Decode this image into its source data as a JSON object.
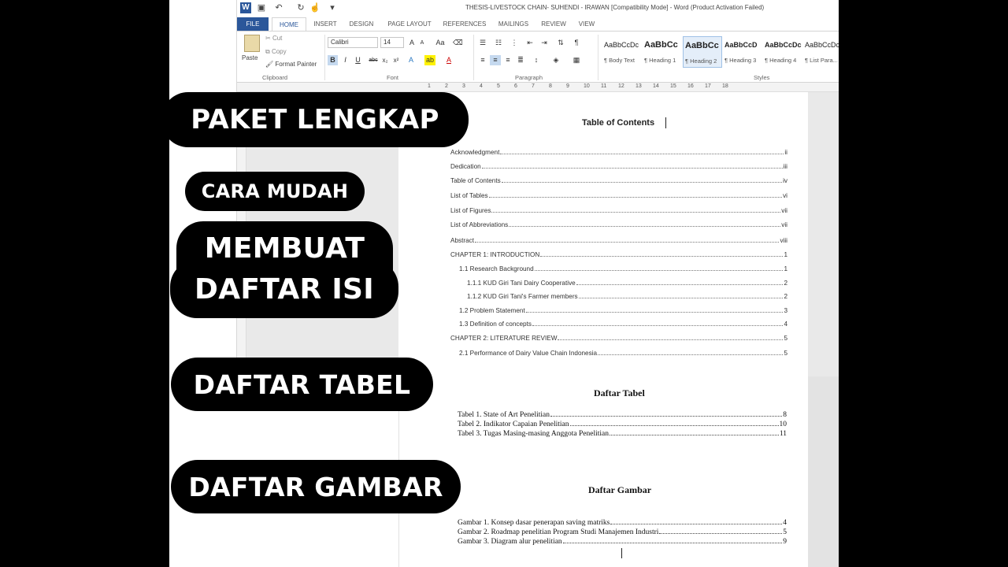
{
  "word": {
    "window_title": "THESIS-LIVESTOCK CHAIN- SUHENDI - IRAWAN  [Compatibility Mode] - Word (Product Activation Failed)",
    "tabs": [
      "FILE",
      "HOME",
      "INSERT",
      "DESIGN",
      "PAGE LAYOUT",
      "REFERENCES",
      "MAILINGS",
      "REVIEW",
      "VIEW"
    ],
    "clipboard": {
      "paste": "Paste",
      "cut": "Cut",
      "copy": "Copy",
      "format_painter": "Format Painter",
      "label": "Clipboard"
    },
    "font": {
      "name": "Calibri",
      "size": "14",
      "label": "Font"
    },
    "paragraph": {
      "label": "Paragraph"
    },
    "styles": {
      "label": "Styles",
      "items": [
        {
          "sample": "AaBbCcDc",
          "name": "¶ Body Text"
        },
        {
          "sample": "AaBbCc",
          "name": "¶ Heading 1"
        },
        {
          "sample": "AaBbCc",
          "name": "¶ Heading 2"
        },
        {
          "sample": "AaBbCcD",
          "name": "¶ Heading 3"
        },
        {
          "sample": "AaBbCcDc",
          "name": "¶ Heading 4"
        },
        {
          "sample": "AaBbCcDc",
          "name": "¶ List Para..."
        }
      ]
    },
    "ruler_numbers": [
      "1",
      "2",
      "3",
      "4",
      "5",
      "6",
      "7",
      "8",
      "9",
      "10",
      "11",
      "12",
      "13",
      "14",
      "15",
      "16",
      "17",
      "18"
    ],
    "toc": {
      "title": "Table of Contents",
      "entries": [
        {
          "label": "Acknowledgment",
          "page": "ii"
        },
        {
          "label": "Dedication",
          "page": "iii"
        },
        {
          "label": "Table of Contents",
          "page": "iv"
        },
        {
          "label": "List of Tables",
          "page": "vi"
        },
        {
          "label": "List of Figures",
          "page": "vii"
        },
        {
          "label": "List of Abbreviations",
          "page": "vii"
        },
        {
          "label": "Abstract",
          "page": "viii"
        },
        {
          "label": "CHAPTER 1: INTRODUCTION",
          "page": "1"
        },
        {
          "label": "1.1 Research Background",
          "page": "1"
        },
        {
          "label": "1.1.1 KUD Giri Tani Dairy Cooperative",
          "page": "2"
        },
        {
          "label": "1.1.2 KUD Giri Tani's Farmer members",
          "page": "2"
        },
        {
          "label": "1.2 Problem Statement",
          "page": "3"
        },
        {
          "label": "1.3 Definition of concepts",
          "page": "4"
        },
        {
          "label": "CHAPTER 2: LITERATURE REVIEW",
          "page": "5"
        },
        {
          "label": "2.1 Performance of Dairy Value Chain Indonesia",
          "page": "5"
        }
      ]
    }
  },
  "daftar_tabel": {
    "title": "Daftar Tabel",
    "entries": [
      {
        "label": "Tabel 1. State of Art Penelitian",
        "page": "8"
      },
      {
        "label": "Tabel 2. Indikator Capaian Penelitian",
        "page": "10"
      },
      {
        "label": "Tabel 3. Tugas Masing-masing Anggota Penelitian",
        "page": "11"
      }
    ]
  },
  "daftar_gambar": {
    "title": "Daftar Gambar",
    "entries": [
      {
        "label": "Gambar 1. Konsep dasar penerapan saving matriks",
        "page": "4"
      },
      {
        "label": "Gambar 2. Roadmap penelitian Program Studi Manajemen Industri",
        "page": "5"
      },
      {
        "label": "Gambar 3. Diagram alur penelitian",
        "page": "9"
      }
    ]
  },
  "overlays": {
    "paket": "PAKET LENGKAP",
    "cara": "CARA MUDAH",
    "membuat": "MEMBUAT",
    "daftar_isi": "DAFTAR ISI",
    "daftar_tabel": "DAFTAR TABEL",
    "daftar_gambar": "DAFTAR GAMBAR"
  },
  "colors": {
    "word_blue": "#2b579a",
    "pill_bg": "#000000",
    "pill_text": "#ffffff"
  }
}
